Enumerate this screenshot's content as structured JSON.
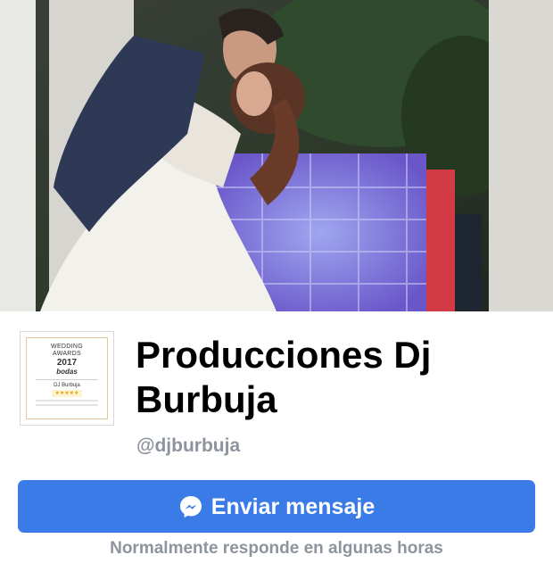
{
  "cover": {
    "description_icon": "cover-photo"
  },
  "avatar": {
    "badge_title_line1": "WEDDING",
    "badge_title_line2": "AWARDS",
    "badge_year": "2017",
    "badge_brand": "bodas",
    "badge_name": "DJ Burbuja",
    "badge_stars": "★★★★★"
  },
  "page": {
    "name": "Producciones Dj Burbuja",
    "handle": "@djburbuja"
  },
  "actions": {
    "send_message_label": "Enviar mensaje",
    "send_message_icon": "messenger-icon"
  },
  "response_note": "Normalmente responde en algunas horas",
  "colors": {
    "button_blue": "#3b7be8",
    "muted_gray": "#8d949e"
  }
}
